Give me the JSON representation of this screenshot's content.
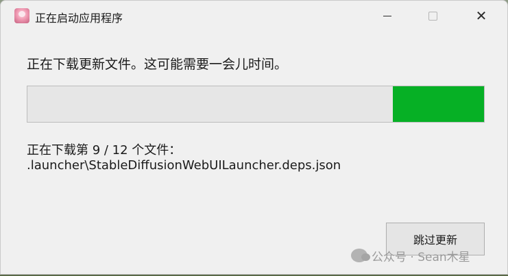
{
  "window": {
    "title": "正在启动应用程序",
    "icon": "app-avatar-icon",
    "controls": {
      "minimize": "minimize-icon",
      "maximize": "maximize-icon",
      "close": "close-icon"
    }
  },
  "dialog": {
    "message": "正在下载更新文件。这可能需要一会儿时间。",
    "progress": {
      "percent": 20,
      "fill_color": "#06b025"
    },
    "status_line_1": "正在下载第 9 / 12 个文件：",
    "status_line_2": ".launcher\\StableDiffusionWebUILauncher.deps.json",
    "skip_button_label": "跳过更新"
  },
  "watermark": {
    "text": "公众号 · Sean木星",
    "icon": "wechat-icon"
  }
}
